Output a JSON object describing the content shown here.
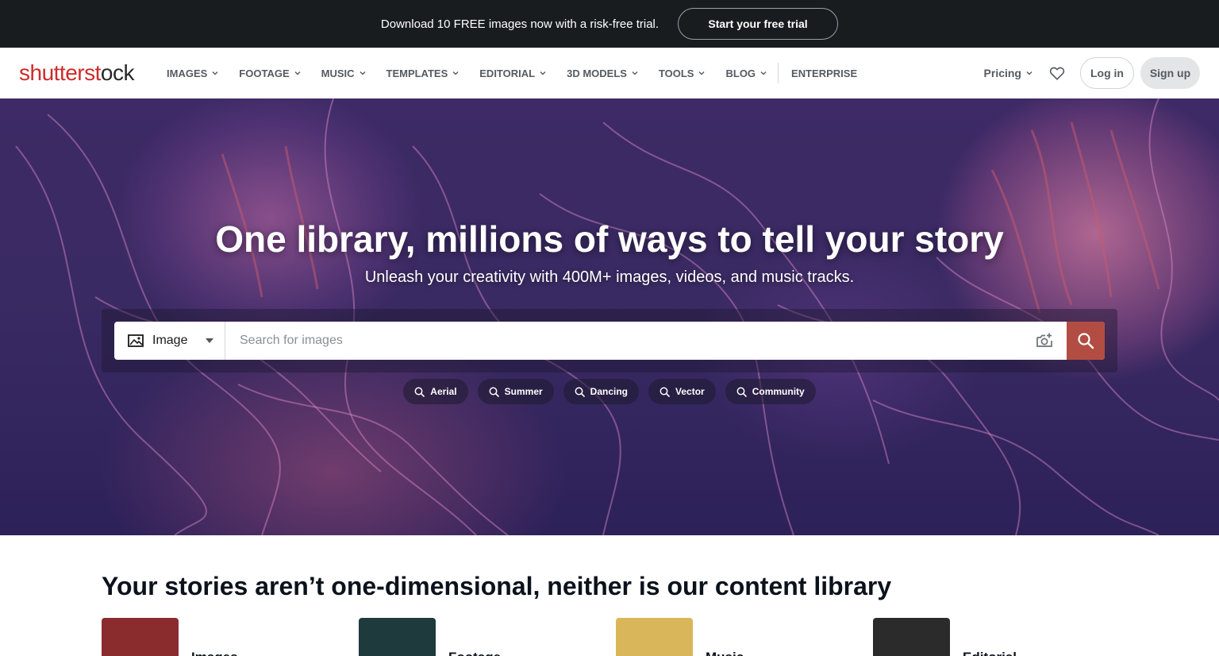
{
  "promo": {
    "text": "Download 10 FREE images now with a risk-free trial.",
    "cta": "Start your free trial"
  },
  "nav": {
    "logo_prefix": "shutterst",
    "logo_mid": "o",
    "logo_suffix": "ck",
    "items": [
      {
        "label": "IMAGES"
      },
      {
        "label": "FOOTAGE"
      },
      {
        "label": "MUSIC"
      },
      {
        "label": "TEMPLATES"
      },
      {
        "label": "EDITORIAL"
      },
      {
        "label": "3D MODELS"
      },
      {
        "label": "TOOLS"
      },
      {
        "label": "BLOG"
      }
    ],
    "enterprise": "ENTERPRISE",
    "pricing": "Pricing",
    "login": "Log in",
    "signup": "Sign up"
  },
  "hero": {
    "title": "One library, millions of ways to tell your story",
    "subtitle": "Unleash your creativity with 400M+ images, videos, and music tracks.",
    "search": {
      "type": "Image",
      "placeholder": "Search for images"
    },
    "chips": [
      "Aerial",
      "Summer",
      "Dancing",
      "Vector",
      "Community"
    ]
  },
  "library": {
    "title": "Your stories aren’t one-dimensional, neither is our content library",
    "categories": [
      {
        "label": "Images",
        "color": "#8a2c2e"
      },
      {
        "label": "Footage",
        "color": "#1f3a3d"
      },
      {
        "label": "Music",
        "color": "#d9b65a"
      },
      {
        "label": "Editorial",
        "color": "#2b2b2b"
      }
    ]
  },
  "colors": {
    "promo_bg": "#191c1f",
    "brand_red": "#ce2b2b",
    "search_button": "#b34d43"
  }
}
